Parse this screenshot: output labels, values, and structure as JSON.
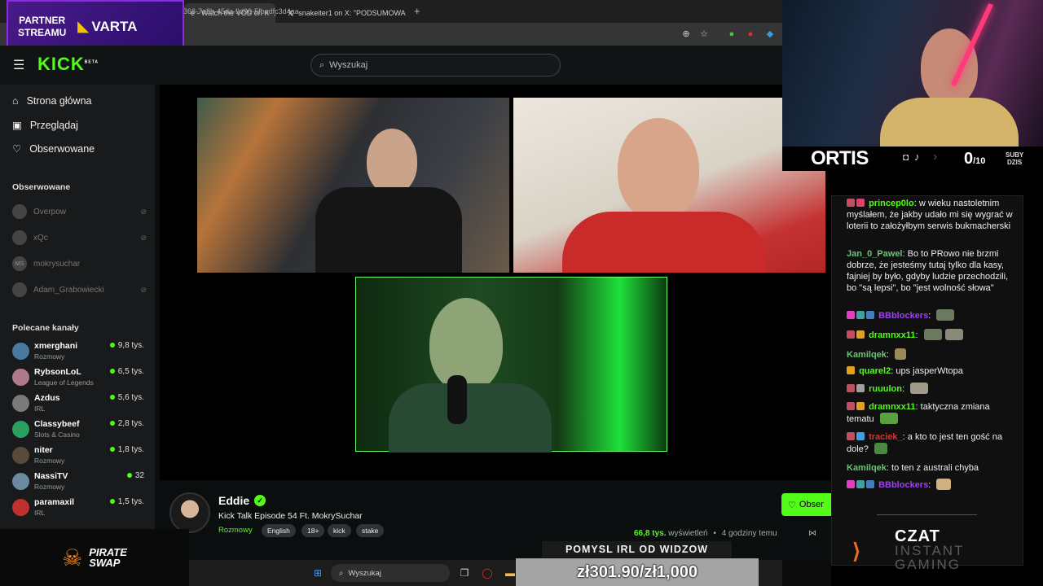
{
  "browser": {
    "tabs": [
      {
        "label": "e - Watch the VOD on K"
      },
      {
        "label": "snakeiter1 on X: \"PODSUMOWA"
      }
    ],
    "new_tab": "+",
    "url": "368-7e8b-45da-9d90-5fbadfc3d4aa"
  },
  "partner": {
    "label": "PARTNER\nSTREAMU",
    "brand": "VARTA"
  },
  "kick": {
    "logo": "KICK",
    "beta": "BETA",
    "search_placeholder": "Wyszukaj",
    "nav": [
      {
        "label": "Strona główna"
      },
      {
        "label": "Przeglądaj"
      },
      {
        "label": "Obserwowane"
      }
    ],
    "followed_title": "Obserwowane",
    "followed": [
      {
        "name": "Overpow"
      },
      {
        "name": "xQc"
      },
      {
        "name": "mokrysuchar",
        "avatar": "MS"
      },
      {
        "name": "Adam_Grabowiecki"
      }
    ],
    "recommended_title": "Polecane kanały",
    "recommended": [
      {
        "name": "xmerghani",
        "category": "Rozmowy",
        "viewers": "9,8 tys.",
        "color": "#4a7aa0"
      },
      {
        "name": "RybsonLoL",
        "category": "League of Legends",
        "viewers": "6,5 tys.",
        "color": "#b07a8a"
      },
      {
        "name": "Azdus",
        "category": "IRL",
        "viewers": "5,6 tys.",
        "color": "#7a7a7a"
      },
      {
        "name": "Classybeef",
        "category": "Slots & Casino",
        "viewers": "2,8 tys.",
        "color": "#2aa060"
      },
      {
        "name": "niter",
        "category": "Rozmowy",
        "viewers": "1,8 tys.",
        "color": "#5a4a3a"
      },
      {
        "name": "NassiTV",
        "category": "Rozmowy",
        "viewers": "32",
        "color": "#6a8aa0"
      },
      {
        "name": "paramaxil",
        "category": "IRL",
        "viewers": "1,5 tys.",
        "color": "#c03030"
      }
    ]
  },
  "stream": {
    "streamer": "Eddie",
    "title": "Kick Talk Episode 54 Ft. MokrySuchar",
    "category": "Rozmowy",
    "tags": [
      "English",
      "18+",
      "kick",
      "stake"
    ],
    "views": "66,8 tys.",
    "views_label": "wyświetleń",
    "time": "4 godziny temu",
    "follow_label": "Obser"
  },
  "taskbar": {
    "search_placeholder": "Wyszukaj"
  },
  "pirate": {
    "line1": "PIRATE",
    "line2": "SWAP"
  },
  "overlay": {
    "idea_title": "POMYSL IRL OD WIDZOW",
    "goal": "zł301.90/zł1,000",
    "streamer_name": "ORTIS",
    "subs_count": "0",
    "subs_total": "/10",
    "subs_label": "SUBY\nDZIS",
    "czat_title": "CZAT",
    "czat_sub": "INSTANT\nGAMING"
  },
  "chat": [
    {
      "user": "princep0lo",
      "color": "#53fc18",
      "text": "w wieku nastoletnim myślałem, że jakby udało mi się wygrać w loterii to założyłbym serwis bukmacherski"
    },
    {
      "user": "Jan_0_Pawel",
      "color": "#6fc27a",
      "text": "Bo to PRowo nie brzmi dobrze, że jesteśmy tutaj tylko dla kasy, fajniej by było, gdyby ludzie przechodzili, bo \"są lepsi\", bo \"jest wolność słowa\""
    },
    {
      "user": "BBblockers",
      "color": "#a040f0",
      "text": ""
    },
    {
      "user": "dramnxx11",
      "color": "#53fc18",
      "text": ""
    },
    {
      "user": "Kamilqek",
      "color": "#6fc27a",
      "text": ""
    },
    {
      "user": "quarel2",
      "color": "#53fc18",
      "text": "ups jasperWtopa"
    },
    {
      "user": "ruuulon",
      "color": "#53fc18",
      "text": ""
    },
    {
      "user": "dramnxx11",
      "color": "#53fc18",
      "text": "taktyczna zmiana tematu"
    },
    {
      "user": "traciek_",
      "color": "#e03030",
      "text": "a kto to jest ten gość na dole?"
    },
    {
      "user": "Kamilqek",
      "color": "#6fc27a",
      "text": "to ten z australi chyba"
    },
    {
      "user": "BBblockers",
      "color": "#a040f0",
      "text": ""
    }
  ]
}
